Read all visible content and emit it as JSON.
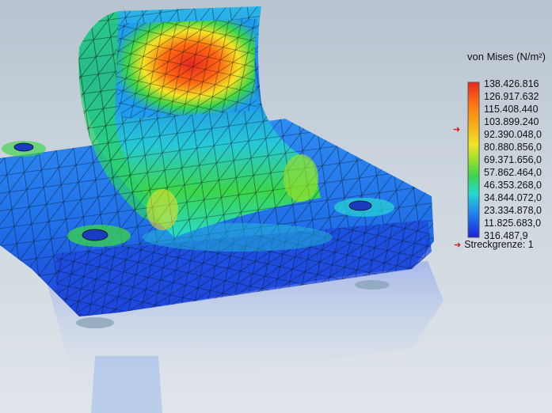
{
  "legend": {
    "title": "von Mises (N/m²)",
    "ticks": [
      "138.426.816",
      "126.917.632",
      "115.408.440",
      "103.899.240",
      "92.390.048,0",
      "80.880.856,0",
      "69.371.656,0",
      "57.862.464,0",
      "46.353.268,0",
      "34.844.072,0",
      "23.334.878,0",
      "11.825.683,0",
      "316.487,9"
    ],
    "yield_label": "Streckgrenze: 1",
    "colors": {
      "max": "#e8281e",
      "high": "#ff7a12",
      "mid_high": "#f4e426",
      "mid": "#3cd64a",
      "mid_low": "#26d8d2",
      "low": "#1f86f0",
      "min": "#1b22d6",
      "yield_marker": "#d01818"
    }
  }
}
